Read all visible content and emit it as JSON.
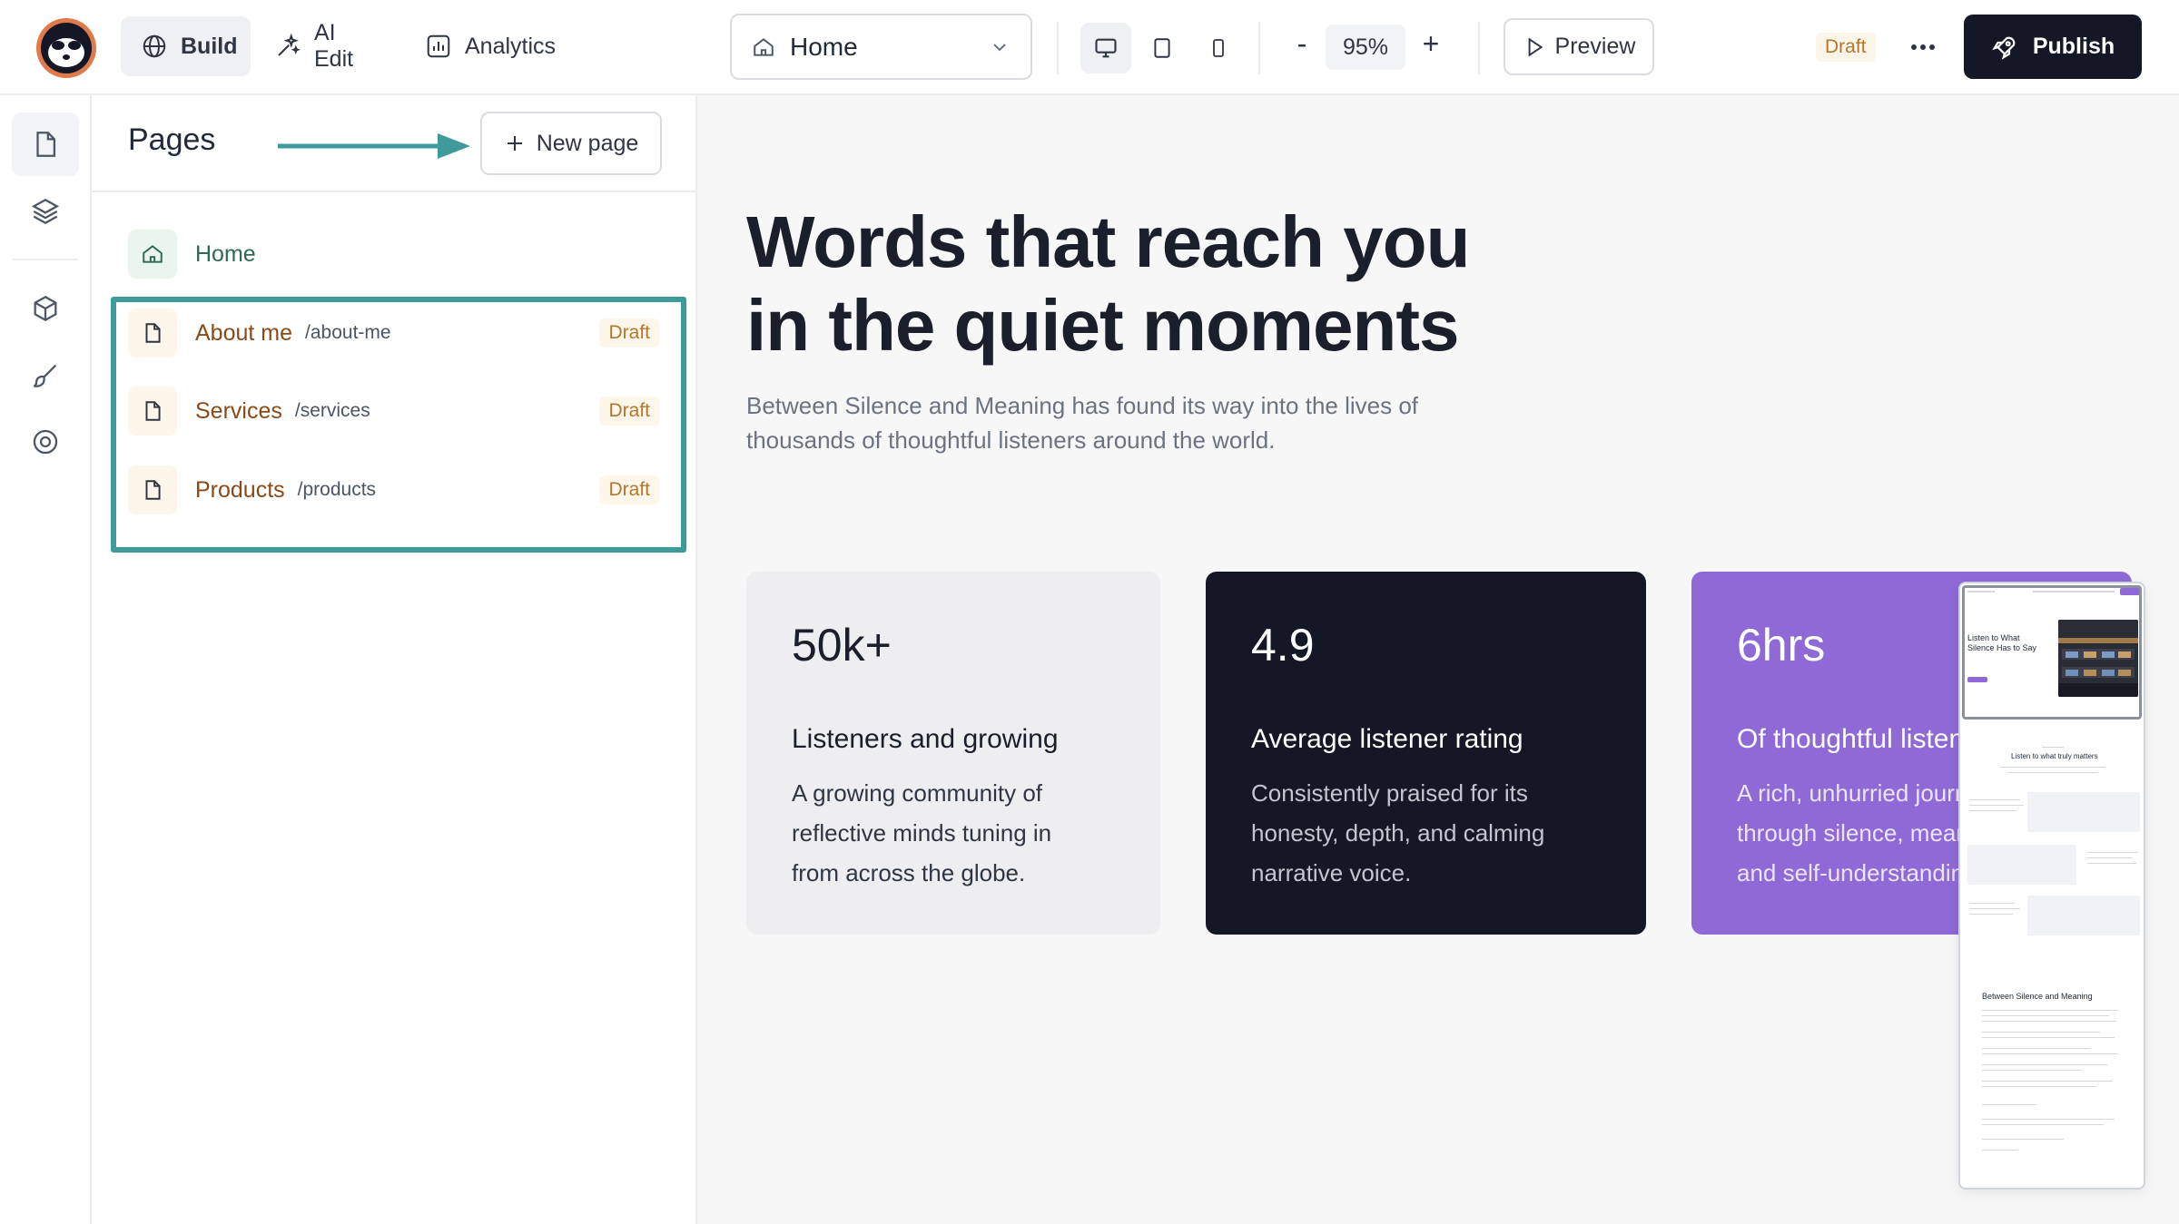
{
  "topbar": {
    "nav": [
      {
        "label": "Build",
        "icon": "globe-icon",
        "active": true
      },
      {
        "label": "AI Edit",
        "icon": "sparkle-icon",
        "active": false
      },
      {
        "label": "Analytics",
        "icon": "chart-icon",
        "active": false
      }
    ],
    "page_select": {
      "value": "Home",
      "icon": "home-icon"
    },
    "devices": [
      "desktop-icon",
      "tablet-icon",
      "mobile-icon"
    ],
    "zoom": {
      "minus": "-",
      "value": "95%",
      "plus": "+"
    },
    "preview_label": "Preview",
    "status": "Draft",
    "publish_label": "Publish"
  },
  "rail": {
    "items": [
      "pages-icon",
      "layers-icon",
      "components-icon",
      "brush-icon",
      "settings-icon"
    ]
  },
  "pages_panel": {
    "title": "Pages",
    "new_page_label": "New page",
    "pages": [
      {
        "name": "Home",
        "slug": "",
        "badge": ""
      },
      {
        "name": "About me",
        "slug": "/about-me",
        "badge": "Draft"
      },
      {
        "name": "Services",
        "slug": "/services",
        "badge": "Draft"
      },
      {
        "name": "Products",
        "slug": "/products",
        "badge": "Draft"
      }
    ]
  },
  "canvas": {
    "hero_title_line1": "Words that reach you",
    "hero_title_line2": "in the quiet moments",
    "hero_sub": "Between Silence and Meaning has found its way into the lives of thousands of thoughtful listeners around the world.",
    "cards": [
      {
        "stat": "50k+",
        "label": "Listeners and growing",
        "desc": "A growing community of reflective minds tuning in from across the globe."
      },
      {
        "stat": "4.9",
        "label": "Average listener rating",
        "desc": "Consistently praised for its honesty, depth, and calming narrative voice."
      },
      {
        "stat": "6hrs",
        "label": "Of thoughtful listening",
        "desc": "A rich, unhurried journey through silence, meaning, and self-understanding."
      }
    ]
  },
  "mini_preview": {
    "hero": "Listen to What Silence Has to Say",
    "section_heading": "Listen to what truly matters",
    "footer_heading": "Between Silence and Meaning"
  },
  "colors": {
    "accent_teal": "#3f9b9b",
    "publish_bg": "#141826",
    "draft_text": "#b4762a",
    "card_purple": "#8f6ad6"
  }
}
